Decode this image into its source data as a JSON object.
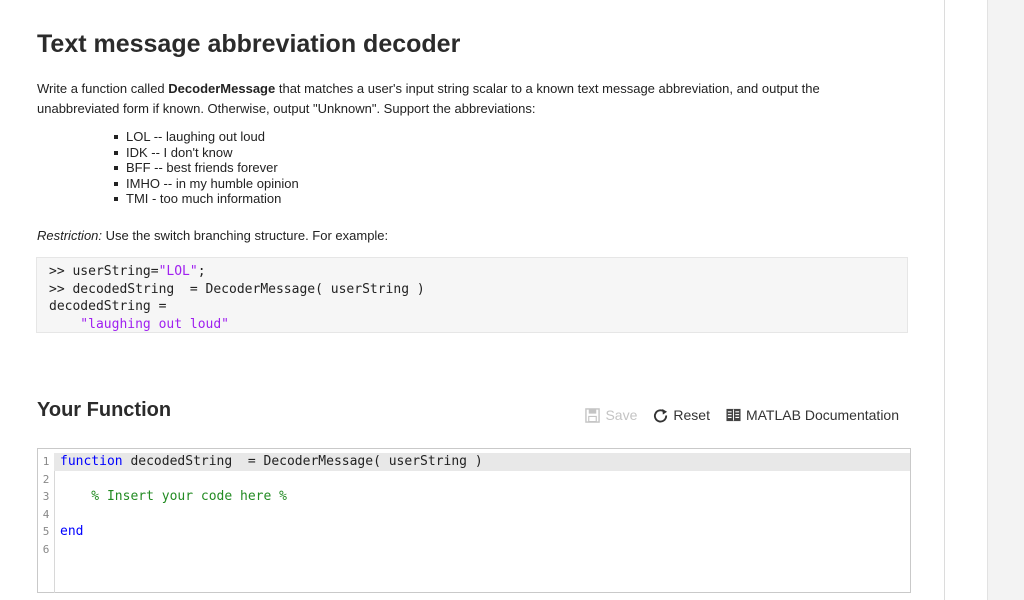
{
  "problem": {
    "title": "Text message abbreviation decoder",
    "desc_pre": "Write a function called ",
    "desc_fn": "DecoderMessage",
    "desc_post": " that matches a user's input string scalar to a known text message abbreviation, and output the unabbreviated form if known. Otherwise, output \"Unknown\". Support the abbreviations:",
    "abbreviations": [
      "LOL -- laughing out loud",
      "IDK -- I don't know",
      "BFF -- best friends forever",
      "IMHO -- in my humble opinion",
      "TMI - too much information"
    ],
    "restriction_label": "Restriction:",
    "restriction_text": " Use the switch branching structure.   For example:"
  },
  "example": {
    "line1_prefix": ">> userString=",
    "line1_string": "\"LOL\"",
    "line1_suffix": ";",
    "line2": ">> decodedString  = DecoderMessage( userString )",
    "line3": "decodedString =",
    "line4_string": "    \"laughing out loud\""
  },
  "your_function": {
    "title": "Your Function",
    "toolbar": {
      "save_label": "Save",
      "reset_label": "Reset",
      "docs_label": "MATLAB Documentation"
    }
  },
  "editor": {
    "line_numbers": [
      "1",
      "2",
      "3",
      "4",
      "5",
      "6"
    ],
    "line1_keyword": "function",
    "line1_rest": " decodedString  = DecoderMessage( userString )",
    "line3_comment": "    % Insert your code here %",
    "line5_keyword": "end"
  },
  "colors": {
    "keyword": "#0000ff",
    "comment": "#228b22",
    "string": "#a020f0"
  }
}
